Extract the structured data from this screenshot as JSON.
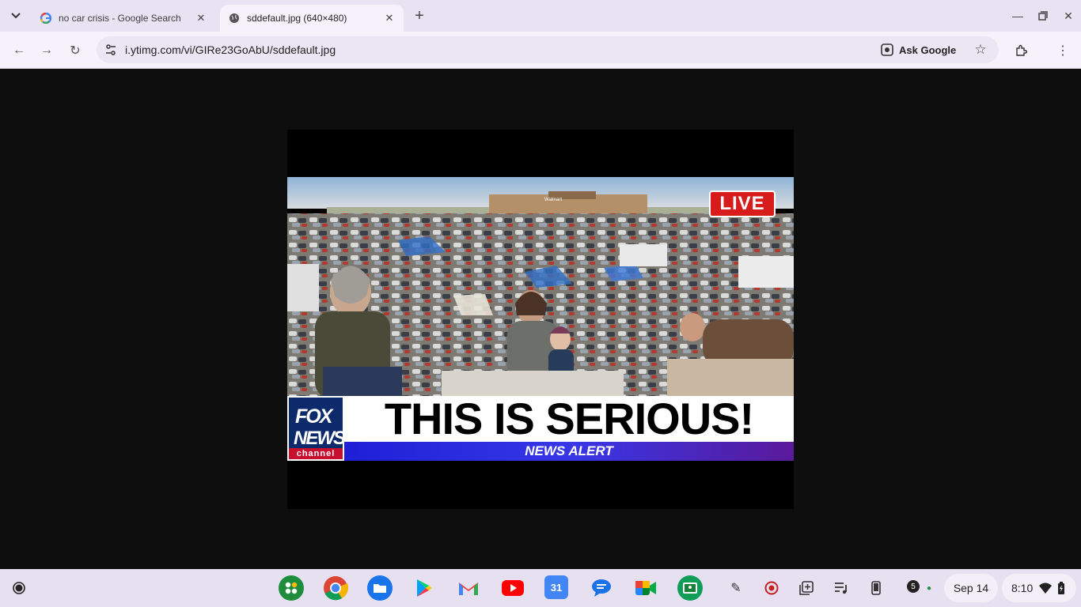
{
  "tabs": [
    {
      "title": "no car crisis - Google Search",
      "active": false
    },
    {
      "title": "sddefault.jpg (640×480)",
      "active": true
    }
  ],
  "toolbar": {
    "url": "i.ytimg.com/vi/GIRe23GoAbU/sddefault.jpg",
    "ask_google": "Ask Google"
  },
  "image": {
    "live_label": "LIVE",
    "logo_line1": "FOX",
    "logo_line2": "NEWS",
    "logo_line3": "channel",
    "store_sign": "Walmart",
    "headline": "THIS IS SERIOUS!",
    "alert": "NEWS ALERT"
  },
  "shelf": {
    "apps": [
      "launcher-grid",
      "chrome",
      "files",
      "play-store",
      "gmail",
      "youtube",
      "calendar",
      "messages",
      "meet",
      "classroom"
    ],
    "calendar_day": "31",
    "notification_count": "5",
    "date": "Sep 14",
    "time": "8:10"
  },
  "colors": {
    "tabstrip": "#e8e3f3",
    "toolbar": "#f6f2fb",
    "live_red": "#d81b1b",
    "fox_blue": "#0d2a6b",
    "alert_blue": "#2b2bdc"
  }
}
